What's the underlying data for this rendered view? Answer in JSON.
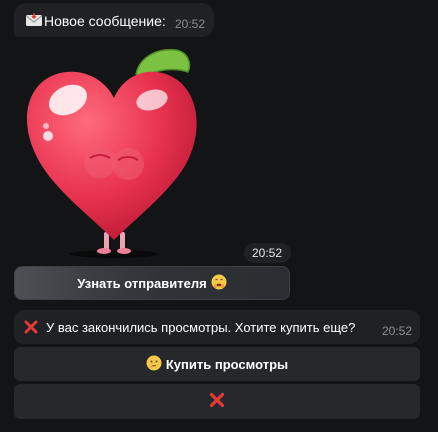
{
  "messages": [
    {
      "icon": "envelope-icon",
      "text": "Новое сообщение:",
      "time": "20:52"
    },
    {
      "icon": "red-cross-icon",
      "text": "У вас закончились просмотры. Хотите купить еще?",
      "time": "20:52"
    }
  ],
  "sticker": {
    "icon": "heart-sticker",
    "time": "20:52"
  },
  "buttons": {
    "reveal_sender": {
      "label": "Узнать отправителя",
      "icon": "hushed-face-icon"
    },
    "buy_views": {
      "label": "Купить просмотры",
      "icon": "thinking-face-icon"
    },
    "cancel": {
      "icon": "red-cross-icon"
    }
  },
  "colors": {
    "background": "#121416",
    "bubble": "#1f2124",
    "button": "#26282c",
    "heart": "#e8334f",
    "cross": "#e53935"
  }
}
